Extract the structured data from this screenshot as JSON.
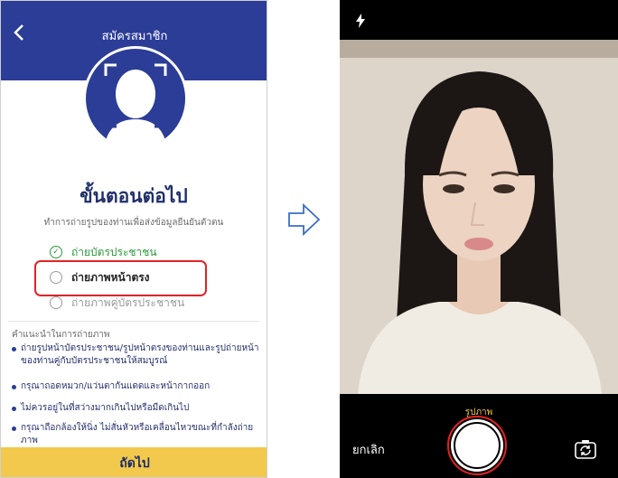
{
  "left": {
    "header": {
      "title": "สมัครสมาชิก"
    },
    "step_title": "ขั้นตอนต่อไป",
    "subtitle": "ทำการถ่ายรูปของท่านเพื่อส่งข้อมูลยืนยันตัวตน",
    "steps": [
      {
        "label": "ถ่ายบัตรประชาชน",
        "state": "done"
      },
      {
        "label": "ถ่ายภาพหน้าตรง",
        "state": "current"
      },
      {
        "label": "ถ่ายภาพคู่บัตรประชาชน",
        "state": "next"
      }
    ],
    "tips_heading": "คำแนะนำในการถ่ายภาพ",
    "tips": [
      "ถ่ายรูปหน้าบัตรประชาชน/รูปหน้าตรงของท่านและรูปถ่ายหน้าของท่านคู่กับบัตรประชาชนให้สมบูรณ์",
      "กรุณาถอดหมวก/แว่นตากันแดดและหน้ากากออก",
      "ไม่ควรอยู่ในที่สว่างมากเกินไปหรือมืดเกินไป",
      "กรุณาถือกล้องให้นิ่ง ไม่สั่นหัวหรือเคลื่อนไหวขณะที่กำลังถ่ายภาพ"
    ],
    "next_button": "ถัดไป"
  },
  "right": {
    "mode_label": "รูปภาพ",
    "cancel_label": "ยกเลิก"
  },
  "colors": {
    "brand_blue": "#2b3d97",
    "accent_yellow": "#f2c94c",
    "highlight_red": "#e32225"
  }
}
